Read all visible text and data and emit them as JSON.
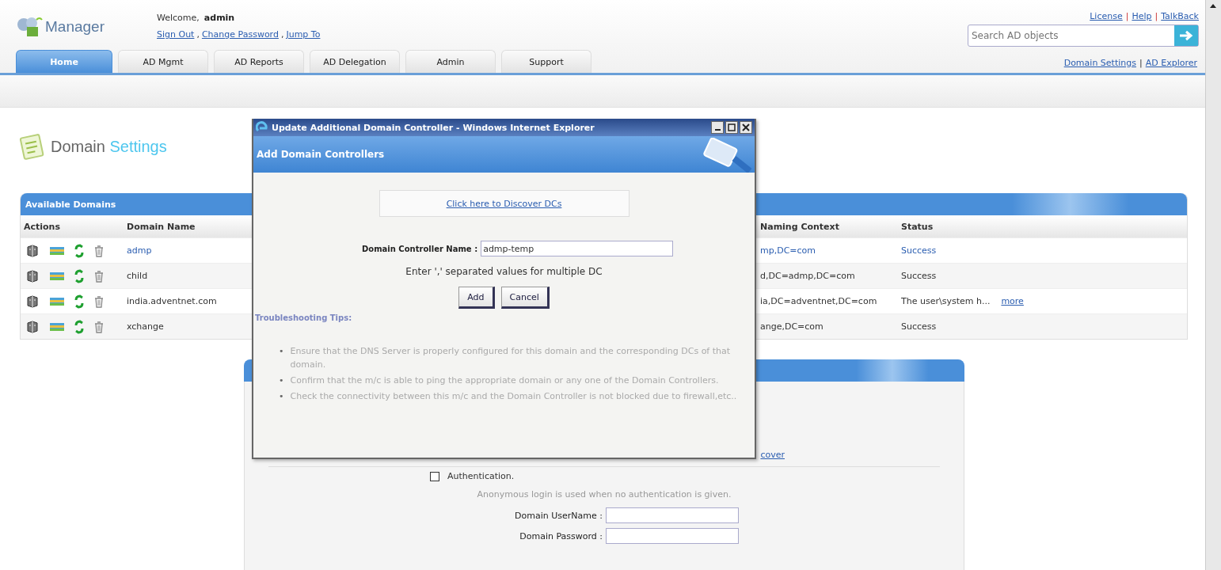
{
  "header": {
    "logo": "Manager",
    "welcome_label": "Welcome,",
    "user": "admin",
    "user_links": [
      "Sign Out",
      "Change Password",
      "Jump To"
    ],
    "user_link_separator": ",",
    "top_links": [
      "License",
      "Help",
      "TalkBack"
    ],
    "top_link_separator": "|",
    "search": {
      "placeholder": "Search AD objects"
    },
    "tabs": [
      {
        "label": "Home",
        "selected": true
      },
      {
        "label": "AD Mgmt",
        "selected": false
      },
      {
        "label": "AD Reports",
        "selected": false
      },
      {
        "label": "AD Delegation",
        "selected": false
      },
      {
        "label": "Admin",
        "selected": false
      },
      {
        "label": "Support",
        "selected": false
      }
    ],
    "sub_links": [
      "Domain Settings",
      "AD Explorer"
    ],
    "sub_link_separator": "|"
  },
  "page_title": {
    "first": "Domain",
    "second": "Settings"
  },
  "domains_panel": {
    "title": "Available Domains",
    "columns": [
      "Actions",
      "Domain Name",
      "Naming Context",
      "Status"
    ],
    "rows": [
      {
        "kind": "linked",
        "name": "admp",
        "naming_context": "mp,DC=com",
        "status": "Success"
      },
      {
        "kind": "plain",
        "name": "child",
        "naming_context": "d,DC=admp,DC=com",
        "status": "Success"
      },
      {
        "kind": "plain",
        "name": "india.adventnet.com",
        "naming_context": "ia,DC=adventnet,DC=com",
        "status": "The user\\system h...",
        "more": "more"
      },
      {
        "kind": "plain",
        "name": "xchange",
        "naming_context": "ange,DC=com",
        "status": "Success"
      }
    ]
  },
  "auth_panel": {
    "partial_link": "cover",
    "checkbox": {
      "label": "Authentication.",
      "checked": false
    },
    "hint": "Anonymous login is used when no authentication is given.",
    "fields": [
      {
        "label": "Domain UserName :"
      },
      {
        "label": "Domain Password :"
      }
    ]
  },
  "dialog": {
    "window_title": "Update Additional Domain Controller - Windows Internet Explorer",
    "heading": "Add Domain Controllers",
    "discover_link": "Click here to Discover DCs",
    "field_label": "Domain Controller Name :",
    "field_value": "admp-temp",
    "hint": "Enter ',' separated values for multiple DC",
    "buttons": [
      "Add",
      "Cancel"
    ],
    "tips_title": "Troubleshooting Tips:",
    "tip_marker": "•",
    "tips": [
      "Ensure that the DNS Server is properly configured for this domain and the corresponding DCs of that domain.",
      "Confirm that the m/c is able to ping the appropriate domain or any one of the Domain Controllers.",
      "Check the connectivity between this m/c and the Domain Controller is not blocked due to firewall,etc.."
    ]
  }
}
